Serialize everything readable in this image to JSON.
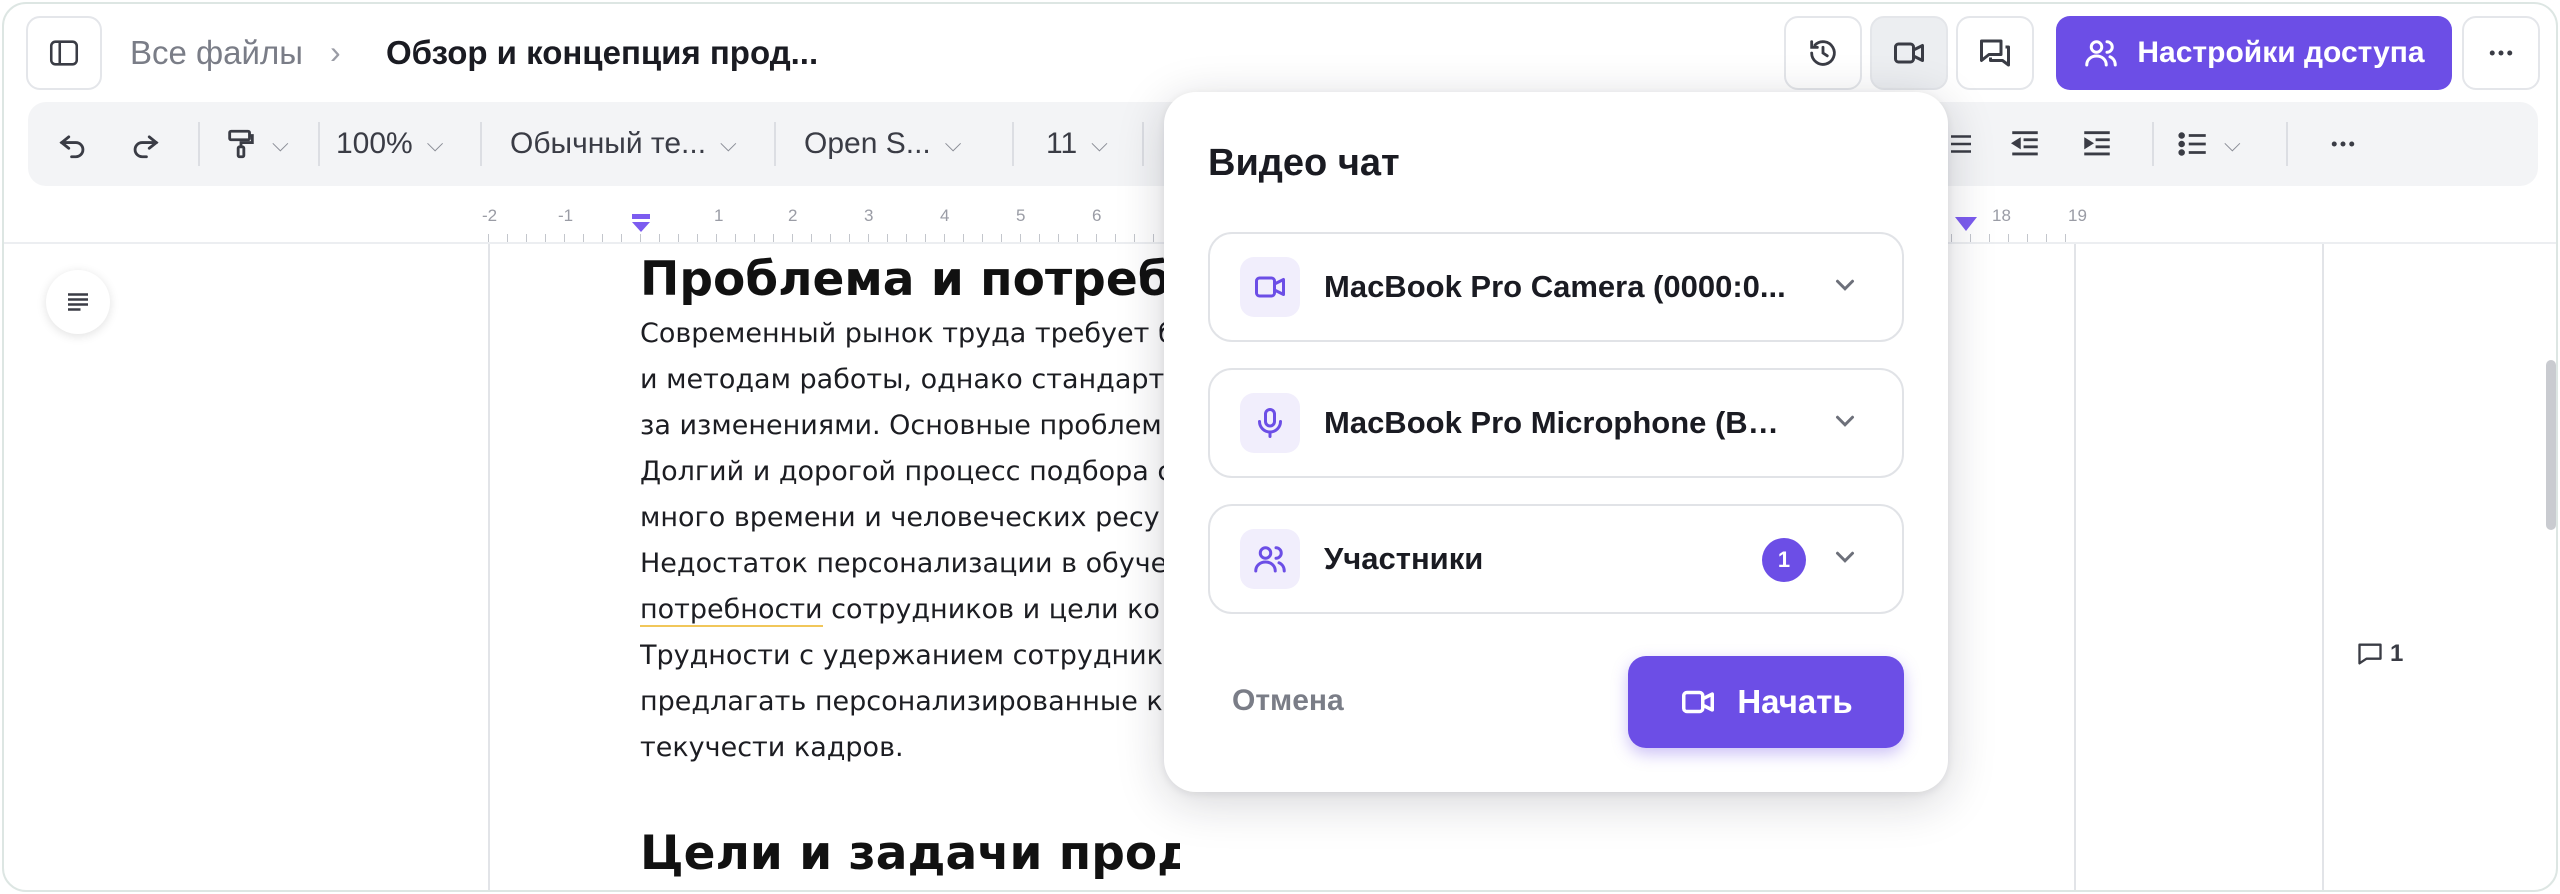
{
  "header": {
    "breadcrumb_root": "Все файлы",
    "breadcrumb_sep": "›",
    "document_title": "Обзор и концепция прод...",
    "share_label": "Настройки доступа"
  },
  "toolbar": {
    "zoom": "100%",
    "style": "Обычный те...",
    "font": "Open S...",
    "font_size": "11"
  },
  "ruler": {
    "labels": [
      "-2",
      "-1",
      "1",
      "2",
      "3",
      "4",
      "5",
      "6",
      "18",
      "19"
    ]
  },
  "document": {
    "heading1": "Проблема и потребн",
    "paragraph_lines": [
      "Современный рынок труда требует б",
      "и методам работы, однако стандартн",
      "за изменениями. Основные проблем",
      "Долгий и дорогой процесс подбора с",
      "много времени и человеческих ресу",
      "Недостаток персонализации в обуче",
      "потребности",
      " сотрудников и цели ко",
      "Трудности с удержанием сотруднико",
      "предлагать персонализированные к",
      "текучести кадров."
    ],
    "heading2": "Цели и задачи продукта",
    "comment_count": "1"
  },
  "video_chat": {
    "title": "Видео чат",
    "camera": "MacBook Pro Camera (0000:0...",
    "microphone": "MacBook Pro Microphone (Buil...",
    "participants_label": "Участники",
    "participants_count": "1",
    "cancel_label": "Отмена",
    "start_label": "Начать"
  },
  "colors": {
    "accent": "#6c4ee6",
    "accent_soft": "#f1eefc"
  }
}
